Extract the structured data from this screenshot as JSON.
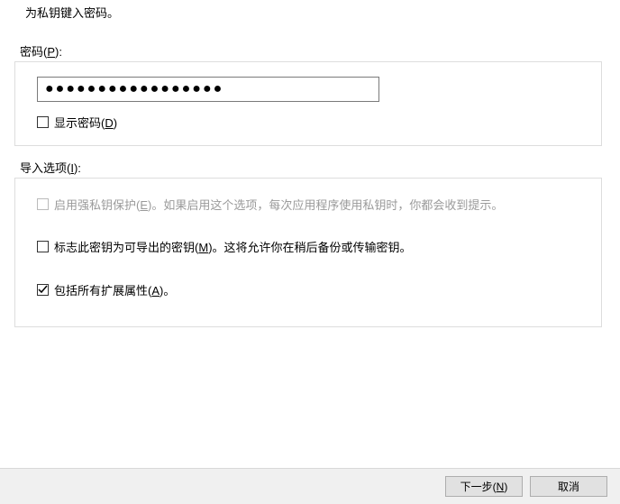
{
  "instruction": "为私钥键入密码。",
  "password": {
    "section_label_pre": "密码(",
    "section_hotkey": "P",
    "section_label_post": "):",
    "value": "●●●●●●●●●●●●●●●●●",
    "show_password": {
      "checked": false,
      "label_pre": "显示密码(",
      "hotkey": "D",
      "label_post": ")"
    }
  },
  "import_options": {
    "section_label_pre": "导入选项(",
    "section_hotkey": "I",
    "section_label_post": "):",
    "strong_protection": {
      "checked": false,
      "disabled": true,
      "label_pre": "启用强私钥保护(",
      "hotkey": "E",
      "label_post": ")。如果启用这个选项，每次应用程序使用私钥时，你都会收到提示。"
    },
    "exportable": {
      "checked": false,
      "disabled": false,
      "label_pre": "标志此密钥为可导出的密钥(",
      "hotkey": "M",
      "label_post": ")。这将允许你在稍后备份或传输密钥。"
    },
    "extended_props": {
      "checked": true,
      "disabled": false,
      "label_pre": "包括所有扩展属性(",
      "hotkey": "A",
      "label_post": ")。"
    }
  },
  "buttons": {
    "next_pre": "下一步(",
    "next_hotkey": "N",
    "next_post": ")",
    "cancel": "取消"
  },
  "watermark": ""
}
